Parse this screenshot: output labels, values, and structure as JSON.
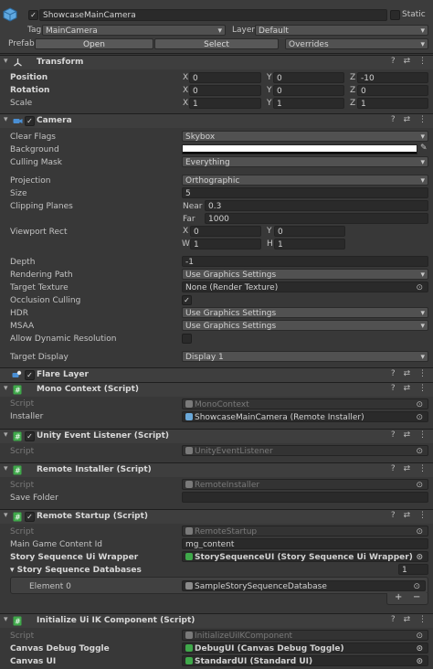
{
  "gameobject": {
    "name": "ShowcaseMainCamera",
    "static_label": "Static",
    "tag_label": "Tag",
    "tag_value": "MainCamera",
    "layer_label": "Layer",
    "layer_value": "Default",
    "prefab_label": "Prefab",
    "open_label": "Open",
    "select_label": "Select",
    "overrides_label": "Overrides"
  },
  "transform": {
    "title": "Transform",
    "position_label": "Position",
    "rotation_label": "Rotation",
    "scale_label": "Scale",
    "x": "X",
    "y": "Y",
    "z": "Z",
    "pos_x": "0",
    "pos_y": "0",
    "pos_z": "-10",
    "rot_x": "0",
    "rot_y": "0",
    "rot_z": "0",
    "scl_x": "1",
    "scl_y": "1",
    "scl_z": "1"
  },
  "camera": {
    "title": "Camera",
    "clear_flags_label": "Clear Flags",
    "clear_flags": "Skybox",
    "background_label": "Background",
    "culling_mask_label": "Culling Mask",
    "culling_mask": "Everything",
    "projection_label": "Projection",
    "projection": "Orthographic",
    "size_label": "Size",
    "size": "5",
    "clipping_label": "Clipping Planes",
    "near_label": "Near",
    "near": "0.3",
    "far_label": "Far",
    "far": "1000",
    "viewport_label": "Viewport Rect",
    "vx": "0",
    "vy": "0",
    "vw": "1",
    "vh": "1",
    "w_label": "W",
    "h_label": "H",
    "depth_label": "Depth",
    "depth": "-1",
    "rendering_path_label": "Rendering Path",
    "rendering_path": "Use Graphics Settings",
    "target_texture_label": "Target Texture",
    "target_texture": "None (Render Texture)",
    "occlusion_label": "Occlusion Culling",
    "occlusion_check": "✓",
    "hdr_label": "HDR",
    "hdr": "Use Graphics Settings",
    "msaa_label": "MSAA",
    "msaa": "Use Graphics Settings",
    "dyn_res_label": "Allow Dynamic Resolution",
    "target_display_label": "Target Display",
    "target_display": "Display 1"
  },
  "flare": {
    "title": "Flare Layer"
  },
  "mono": {
    "title": "Mono Context (Script)",
    "script_label": "Script",
    "script": "MonoContext",
    "installer_label": "Installer",
    "installer": "ShowcaseMainCamera (Remote Installer)"
  },
  "uel": {
    "title": "Unity Event Listener (Script)",
    "script_label": "Script",
    "script": "UnityEventListener"
  },
  "remote_installer": {
    "title": "Remote Installer (Script)",
    "script_label": "Script",
    "script": "RemoteInstaller",
    "save_folder_label": "Save Folder"
  },
  "remote_startup": {
    "title": "Remote Startup (Script)",
    "script_label": "Script",
    "script": "RemoteStartup",
    "main_game_label": "Main Game Content Id",
    "main_game": "mg_content",
    "wrapper_label": "Story Sequence Ui Wrapper",
    "wrapper": "StorySequenceUI (Story Sequence Ui Wrapper)",
    "databases_label": "Story Sequence Databases",
    "databases_count": "1",
    "element0_label": "Element 0",
    "element0": "SampleStorySequenceDatabase",
    "plus": "+",
    "minus": "−"
  },
  "ik": {
    "title": "Initialize Ui IK Component (Script)",
    "script_label": "Script",
    "script": "InitializeUiIKComponent",
    "debug_label": "Canvas Debug Toggle",
    "debug": "DebugUI (Canvas Debug Toggle)",
    "canvas_label": "Canvas UI",
    "canvas": "StandardUI (Standard UI)"
  },
  "icons": {
    "help": "?",
    "settings": "⇄",
    "menu": "⋮",
    "target": "⊙",
    "check": "✓",
    "foldout": "▾",
    "picker": "✎"
  },
  "colors": {
    "script_icon": "#3fa84a",
    "camera_icon": "#4a8fd4",
    "transform_icon": "#d8d8d8"
  }
}
